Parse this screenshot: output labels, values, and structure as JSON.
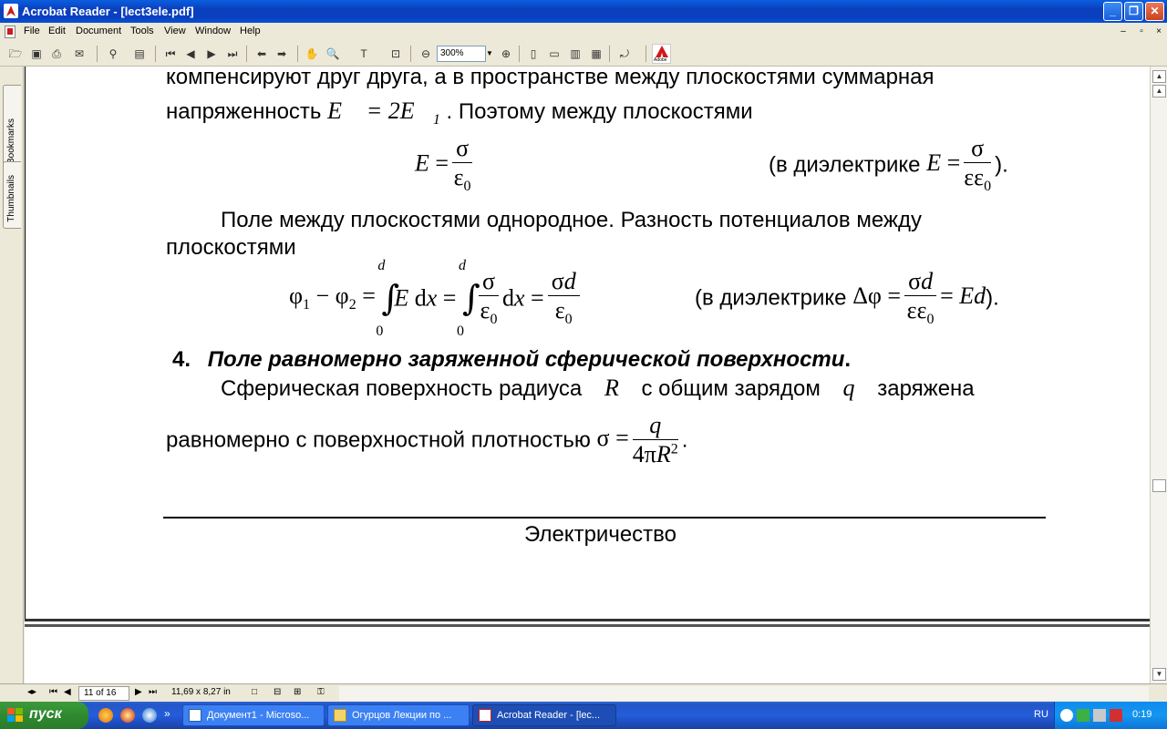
{
  "window": {
    "title": "Acrobat Reader - [lect3ele.pdf]",
    "buttons": {
      "minimize": "_",
      "restore": "❐",
      "close": "✕"
    }
  },
  "menu": {
    "items": [
      "File",
      "Edit",
      "Document",
      "Tools",
      "View",
      "Window",
      "Help"
    ],
    "mdi": {
      "minimize": "–",
      "restore": "▫",
      "close": "×"
    }
  },
  "toolbar": {
    "zoom_value": "300%"
  },
  "navpanel": {
    "tabs": [
      "Bookmarks",
      "Thumbnails"
    ]
  },
  "document": {
    "p1_line1": "компенсируют   друг   друга,   а   в   пространстве   между   плоскостями   суммарная",
    "p1_line2_pre": "напряженность ",
    "p1_line2_post": ". Поэтому между плоскостями",
    "eq1_dielectric_pre": "(в диэлектрике ",
    "eq1_dielectric_post": ").",
    "p2_line1": "Поле   между   плоскостями   однородное.   Разность   потенциалов   между",
    "p2_line2": "плоскостями",
    "eq2_dielectric_pre": "(в диэлектрике ",
    "eq2_dielectric_post": ").",
    "section_number": "4.",
    "section_title": "Поле равномерно заряженной сферической поверхности",
    "section_period": ".",
    "p3_line1_a": "Сферическая   поверхность   радиуса",
    "p3_line1_b": "с   общим   зарядом",
    "p3_line1_c": "заряжена",
    "p3_line2": "равномерно с поверхностной плотностью ",
    "p3_line2_end": ".",
    "footer": "Электричество"
  },
  "statusbar": {
    "page": "11 of 16",
    "page_size": "11,69 x 8,27 in"
  },
  "taskbar": {
    "start_label": "пуск",
    "tasks": [
      {
        "label": "Документ1 - Microso..."
      },
      {
        "label": "Огурцов Лекции по ..."
      },
      {
        "label": "Acrobat Reader - [lec..."
      }
    ],
    "lang": "RU",
    "clock": "0:19"
  },
  "colors": {
    "titlebar": "#0A3FBE",
    "taskbar": "#245DDB",
    "start": "#2F8A2F",
    "chrome": "#ECE9D8"
  }
}
